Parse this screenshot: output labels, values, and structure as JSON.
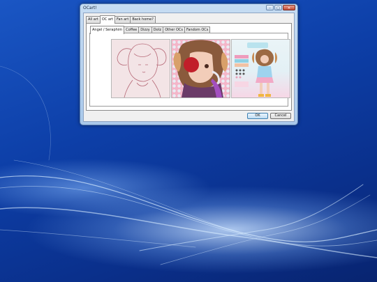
{
  "window": {
    "title": "OCart!",
    "minimize_glyph": "–",
    "maximize_glyph": "□",
    "close_glyph": "✕"
  },
  "tabs": [
    {
      "label": "All art",
      "active": false
    },
    {
      "label": "OC art",
      "active": true
    },
    {
      "label": "Fan art",
      "active": false
    },
    {
      "label": "Back home?",
      "active": false
    }
  ],
  "inner_tabs": [
    {
      "label": "Angel / Seraphim",
      "active": true
    },
    {
      "label": "Coffee",
      "active": false
    },
    {
      "label": "Dizzy",
      "active": false
    },
    {
      "label": "Dotz",
      "active": false
    },
    {
      "label": "Other OCs",
      "active": false
    },
    {
      "label": "Fandom OCs",
      "active": false
    }
  ],
  "gallery": [
    {
      "name": "angel-sketch-artwork"
    },
    {
      "name": "angel-colored-artwork"
    },
    {
      "name": "angel-reference-sheet-artwork"
    }
  ],
  "buttons": {
    "ok_label": "OK",
    "cancel_label": "Cancel"
  },
  "colors": {
    "desktop": "#0d3fa8",
    "window_frame": "#a9c8ea",
    "close_button": "#c24a35",
    "ok_button_border": "#3c7fb1"
  }
}
